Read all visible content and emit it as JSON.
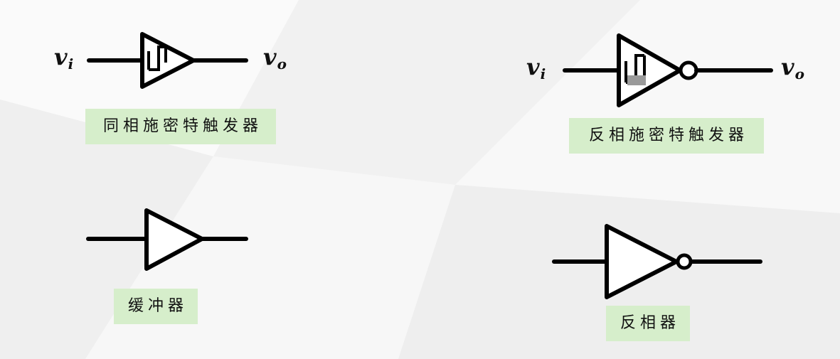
{
  "background_color": "#f4f4f4",
  "label_color": "#d6eecb",
  "line_color": "#000000",
  "symbols": [
    {
      "name": "non-inverting-schmitt-trigger",
      "label": "同相施密特触发器",
      "input": {
        "main": "v",
        "sub": "i"
      },
      "output": {
        "main": "v",
        "sub": "o"
      }
    },
    {
      "name": "inverting-schmitt-trigger",
      "label": "反相施密特触发器",
      "input": {
        "main": "v",
        "sub": "i"
      },
      "output": {
        "main": "v",
        "sub": "o"
      }
    },
    {
      "name": "buffer",
      "label": "缓冲器"
    },
    {
      "name": "inverter",
      "label": "反相器"
    }
  ]
}
